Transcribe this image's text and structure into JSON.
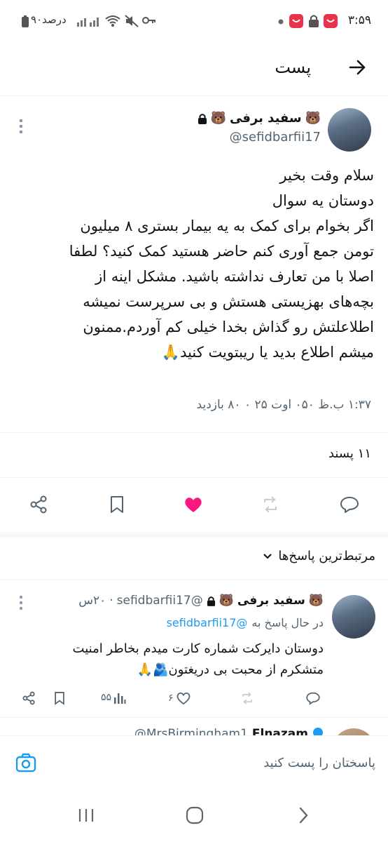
{
  "status_bar": {
    "time": "۳:۵۹",
    "battery": "۹۰درصد"
  },
  "header": {
    "title": "پست"
  },
  "post": {
    "author_name": "سفید برفی",
    "author_handle": "@sefidbarfii17",
    "body": "سلام وقت بخیر\nدوستان یه سوال\nاگر بخوام برای کمک به یه بیمار بستری ۸ میلیون\nتومن جمع آوری کنم حاضر هستید کمک کنید؟ لطفا\nاصلا با من تعارف نداشته باشید. مشکل اینه از\nبچه‌های بهزیستی هستش و بی سرپرست نمیشه\nاطلاعلتش رو گذاش بخدا خیلی کم آوردم.ممنون\nمیشم اطلاع بدید یا ریبتویت کنید🙏",
    "meta": "۱:۳۷ ب.ظ ۰۵۰ اوت ۲۵ ۰ ۸۰ بازدید",
    "likes": "۱۱ پسند"
  },
  "replies_filter": {
    "label": "مرتبط‌ترین پاسخ‌ها"
  },
  "reply": {
    "author_name": "سفید برفی",
    "author_handle": "@sefidbarfii17",
    "time": "۲۰س",
    "replying_to_prefix": "در حال پاسخ به",
    "replying_to_handle": "@sefidbarfii17",
    "body": "دوستان دایرکت شماره کارت میدم  بخاطر امنیت\nمتشکرم از محبت بی دریغتون🫂🙏",
    "views": "۵۵",
    "likes": "۶"
  },
  "next_reply": {
    "author_name": "Elnazam",
    "author_handle": "@MrsBirmingham1"
  },
  "reply_bar": {
    "placeholder": "پاسختان را پست کنید"
  },
  "colors": {
    "accent": "#1d9bf0",
    "like": "#f91880",
    "text": "#0f1419",
    "secondary": "#536471"
  }
}
